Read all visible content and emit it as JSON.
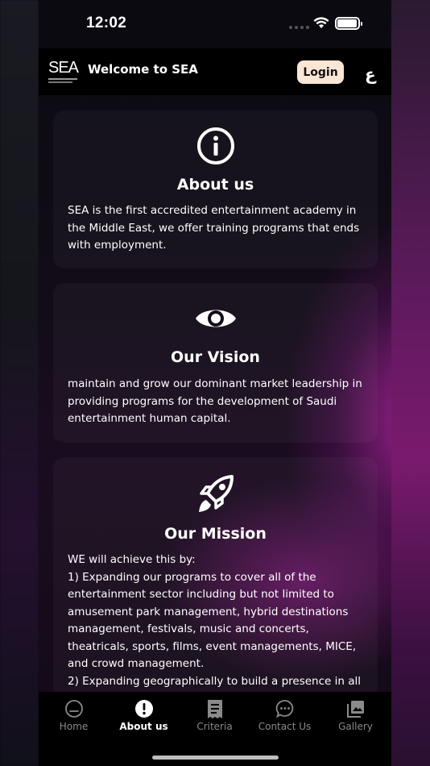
{
  "status_bar": {
    "time": "12:02"
  },
  "header": {
    "logo_text": "SEA",
    "welcome": "Welcome to SEA",
    "login_label": "Login",
    "language_toggle": "ع"
  },
  "cards": [
    {
      "icon": "info-icon",
      "title": "About us",
      "body": "SEA is the first accredited entertainment academy in the Middle East, we offer training programs that ends with employment."
    },
    {
      "icon": "eye-icon",
      "title": "Our Vision",
      "body": "maintain and grow our dominant market leadership in providing programs for the development of Saudi entertainment human capital."
    },
    {
      "icon": "rocket-icon",
      "title": "Our Mission",
      "body_lines": [
        "WE will achieve this by:",
        "1) Expanding our programs to cover all of the entertainment sector including but not limited to amusement park management, hybrid destinations management, festivals, music and concerts, theatricals, sports, films, event managements, MICE, and crowd management.",
        "2) Expanding geographically to build a presence in all"
      ]
    }
  ],
  "tabs": [
    {
      "label": "Home",
      "icon": "home-icon",
      "active": false
    },
    {
      "label": "About us",
      "icon": "exclamation-icon",
      "active": true
    },
    {
      "label": "Criteria",
      "icon": "receipt-icon",
      "active": false
    },
    {
      "label": "Contact Us",
      "icon": "chat-bubble-icon",
      "active": false
    },
    {
      "label": "Gallery",
      "icon": "gallery-icon",
      "active": false
    }
  ],
  "colors": {
    "accent_magenta": "#c828b4",
    "login_bg": "#fbe6d6",
    "inactive_tab": "#8a8a8a"
  }
}
